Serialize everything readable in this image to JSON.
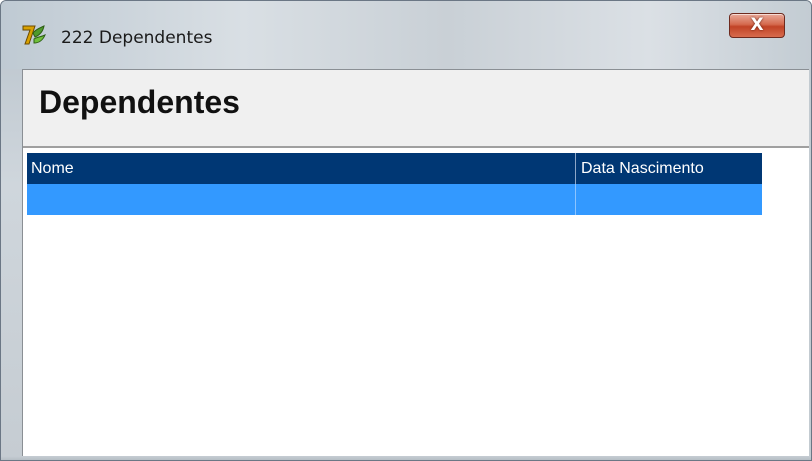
{
  "window": {
    "title": "222 Dependentes",
    "close_label": "X",
    "app_icon": "delphi-app-icon",
    "colors": {
      "grid_header_bg": "#003774",
      "grid_selected_row_bg": "#3399ff",
      "close_button": "#c14326"
    }
  },
  "header": {
    "title": "Dependentes"
  },
  "grid": {
    "columns": [
      "Nome",
      "Data Nascimento"
    ],
    "rows": [
      [
        "",
        ""
      ]
    ]
  }
}
